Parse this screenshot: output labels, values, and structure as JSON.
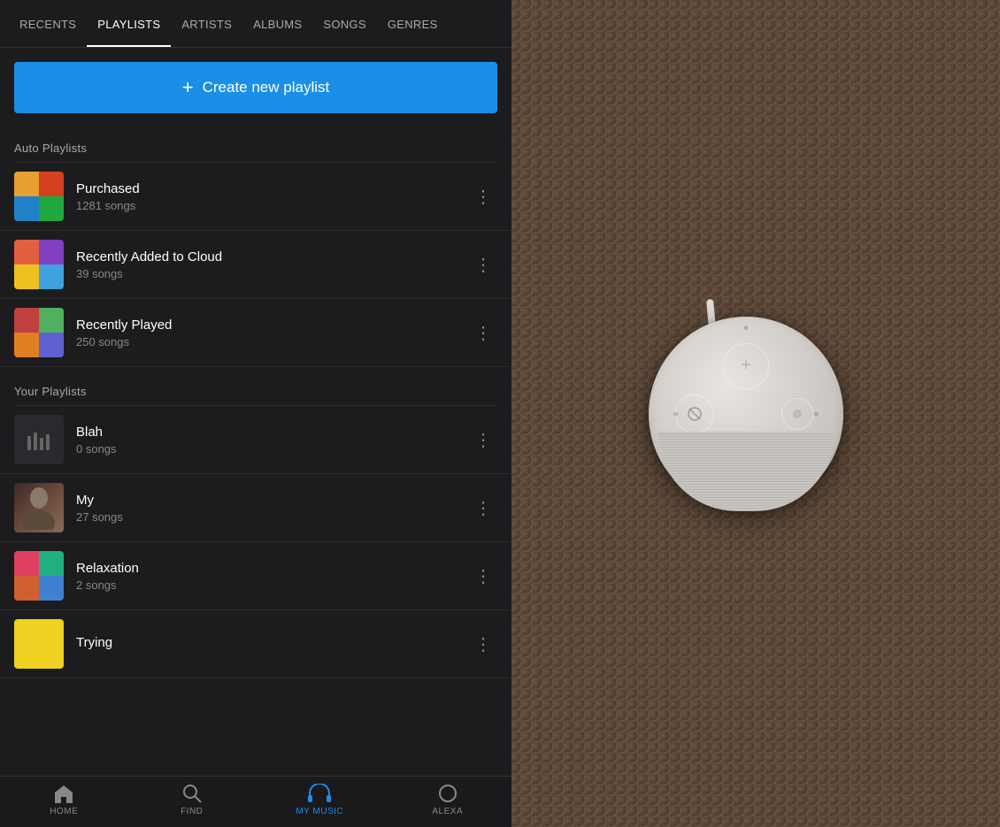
{
  "nav": {
    "items": [
      {
        "label": "RECENTS",
        "active": false
      },
      {
        "label": "PLAYLISTS",
        "active": true
      },
      {
        "label": "ARTISTS",
        "active": false
      },
      {
        "label": "ALBUMS",
        "active": false
      },
      {
        "label": "SONGS",
        "active": false
      },
      {
        "label": "GENRES",
        "active": false
      }
    ]
  },
  "create_btn": {
    "icon": "+",
    "label": "Create new playlist"
  },
  "auto_playlists": {
    "section_label": "Auto Playlists",
    "items": [
      {
        "name": "Purchased",
        "count": "1281 songs"
      },
      {
        "name": "Recently Added to Cloud",
        "count": "39 songs"
      },
      {
        "name": "Recently Played",
        "count": "250 songs"
      }
    ]
  },
  "your_playlists": {
    "section_label": "Your Playlists",
    "items": [
      {
        "name": "Blah",
        "count": "0 songs"
      },
      {
        "name": "My",
        "count": "27 songs"
      },
      {
        "name": "Relaxation",
        "count": "2 songs"
      },
      {
        "name": "Trying",
        "count": ""
      }
    ]
  },
  "bottom_nav": {
    "items": [
      {
        "label": "HOME",
        "icon": "⌂",
        "active": false
      },
      {
        "label": "FIND",
        "icon": "🔍",
        "active": false
      },
      {
        "label": "MY MUSIC",
        "icon": "🎧",
        "active": true
      },
      {
        "label": "ALEXA",
        "icon": "◯",
        "active": false
      }
    ]
  },
  "more_btn_label": "⋮"
}
